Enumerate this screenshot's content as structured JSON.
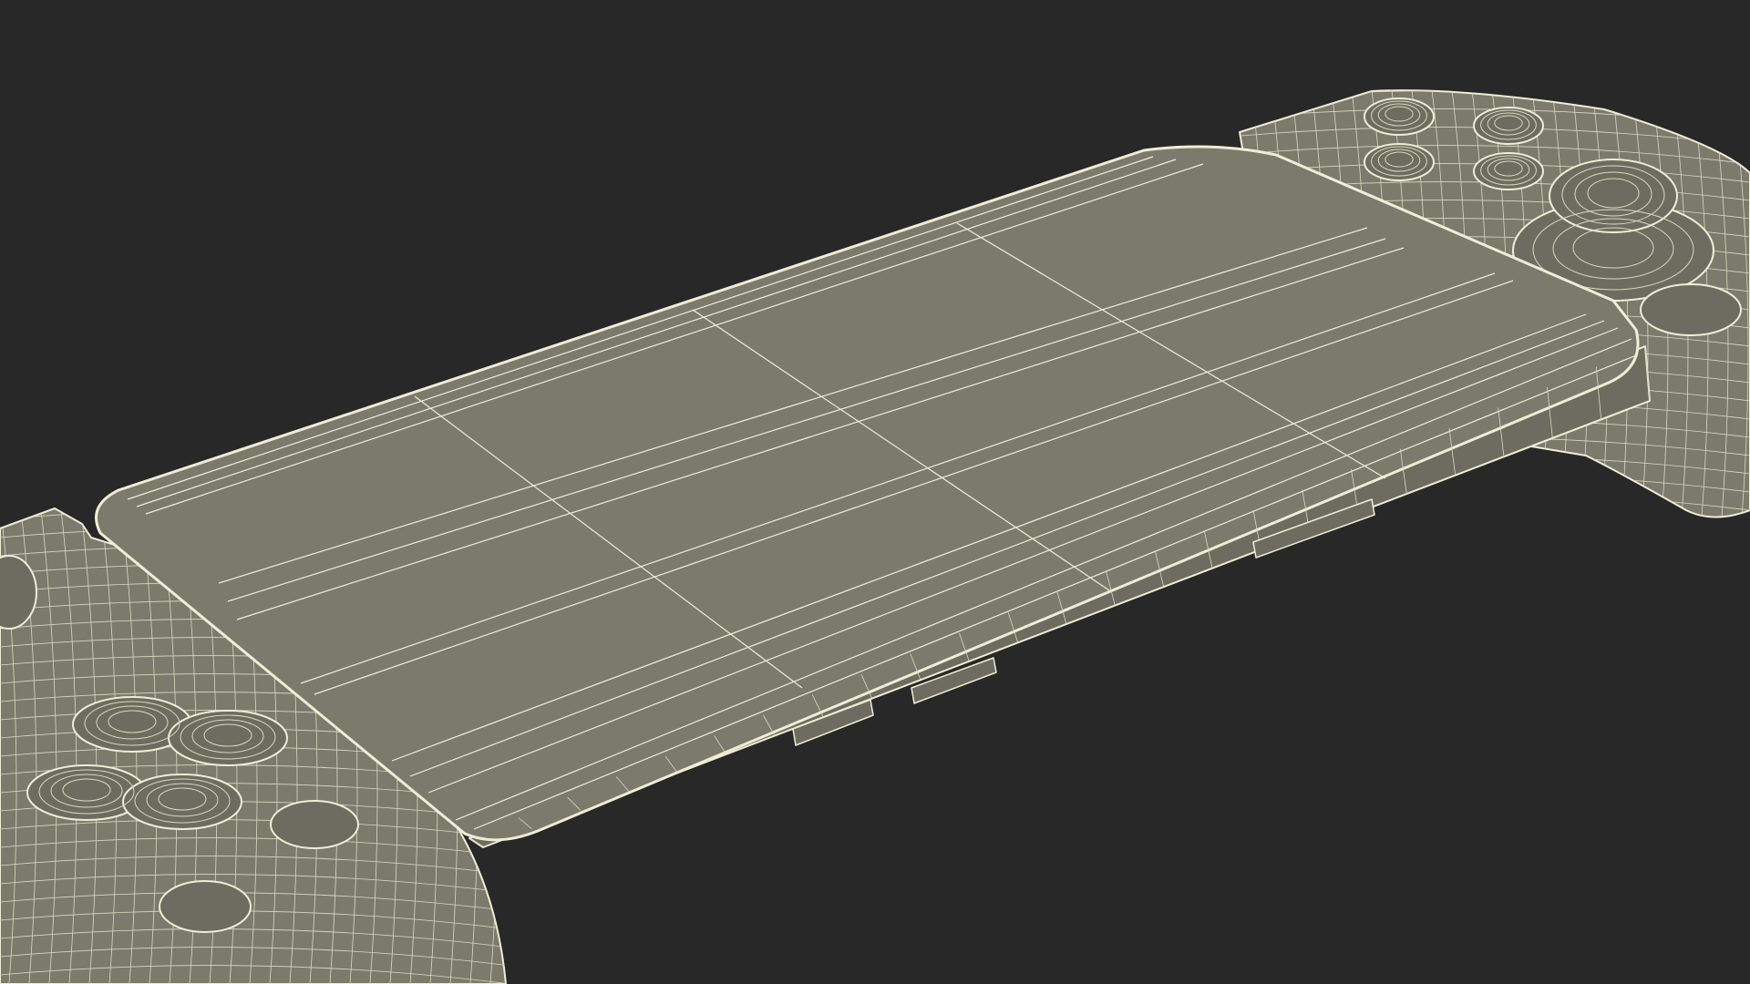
{
  "scene": {
    "subject": "controller-with-phone",
    "render_style": "wireframe",
    "colors": {
      "background": "#272827",
      "surface": "#7a7b6c",
      "surface_dark": "#6c6d60",
      "wire": "#eeeed6",
      "wire_soft": "#d9d9c0"
    },
    "parts": {
      "phone": "phone-body",
      "left_grip": "left-grip",
      "right_grip": "right-grip",
      "face_buttons": 4,
      "dpad_buttons": 4,
      "side_buttons": 3
    }
  }
}
